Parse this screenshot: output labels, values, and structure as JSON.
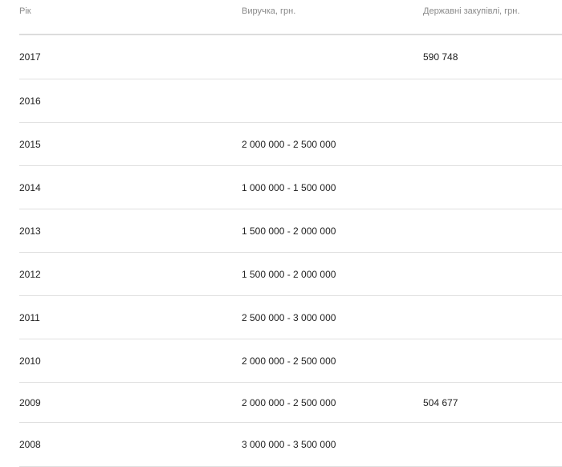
{
  "table": {
    "headers": [
      "Рік",
      "Виручка, грн.",
      "Державні закупівлі, грн."
    ],
    "rows": [
      {
        "year": "2017",
        "revenue": "",
        "procurement": "590 748"
      },
      {
        "year": "2016",
        "revenue": "",
        "procurement": ""
      },
      {
        "year": "2015",
        "revenue": "2 000 000 - 2 500 000",
        "procurement": ""
      },
      {
        "year": "2014",
        "revenue": "1 000 000 - 1 500 000",
        "procurement": ""
      },
      {
        "year": "2013",
        "revenue": "1 500 000 - 2 000 000",
        "procurement": ""
      },
      {
        "year": "2012",
        "revenue": "1 500 000 - 2 000 000",
        "procurement": ""
      },
      {
        "year": "2011",
        "revenue": "2 500 000 - 3 000 000",
        "procurement": ""
      },
      {
        "year": "2010",
        "revenue": "2 000 000 - 2 500 000",
        "procurement": ""
      },
      {
        "year": "2009",
        "revenue": "2 000 000 - 2 500 000",
        "procurement": "504 677"
      },
      {
        "year": "2008",
        "revenue": "3 000 000 - 3 500 000",
        "procurement": ""
      }
    ]
  }
}
